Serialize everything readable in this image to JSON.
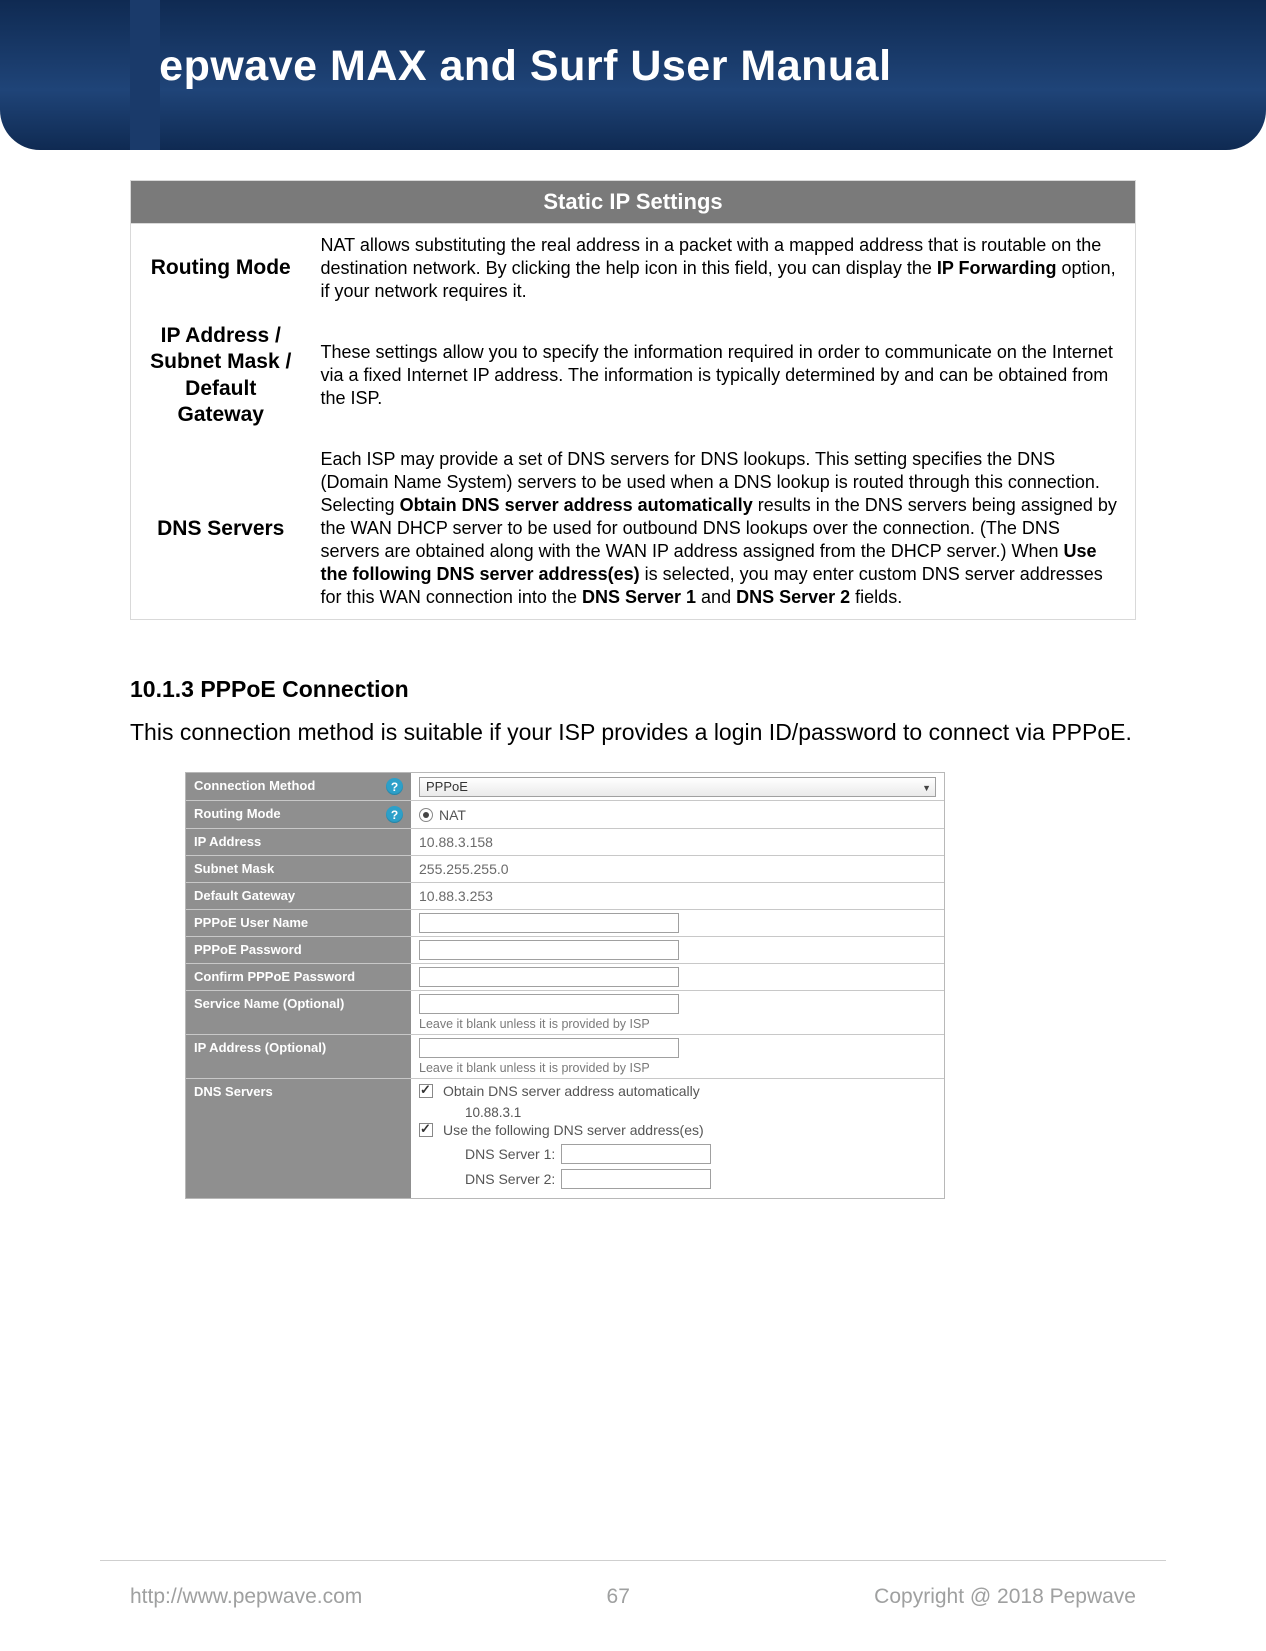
{
  "header": {
    "title": "Pepwave MAX and Surf User Manual"
  },
  "static_ip": {
    "title": "Static IP Settings",
    "rows": [
      {
        "label": "Routing Mode",
        "desc_pre": "NAT allows substituting the real address in a packet with a mapped address that is routable on the destination network. By clicking the help icon in this field, you can display the ",
        "bold1": "IP Forwarding",
        "desc_post": " option, if your network requires it."
      },
      {
        "label": "IP Address / Subnet Mask / Default Gateway",
        "desc_pre": "These settings allow you to specify the information required in order to communicate on the Internet via a fixed Internet IP address. The information is typically determined by and can be obtained from the ISP.",
        "bold1": "",
        "desc_post": ""
      },
      {
        "label": "DNS Servers",
        "desc_pre": "Each ISP may provide a set of DNS servers for DNS lookups. This setting specifies the DNS (Domain Name System) servers to be used when a DNS lookup is routed through this connection. Selecting ",
        "bold1": "Obtain DNS server address automatically",
        "desc_mid1": " results in the DNS servers being assigned by the WAN DHCP server to be used for outbound DNS lookups over the connection. (The DNS servers are obtained along with the WAN IP address assigned from the DHCP server.) When ",
        "bold2": "Use the following DNS server address(es)",
        "desc_mid2": " is selected, you may enter custom DNS server addresses for this WAN connection into the ",
        "bold3": "DNS Server 1",
        "desc_mid3": " and ",
        "bold4": "DNS Server 2",
        "desc_post": " fields."
      }
    ]
  },
  "section": {
    "heading": "10.1.3 PPPoE Connection",
    "para": "This connection method is suitable if your ISP provides a login ID/password to connect via PPPoE."
  },
  "config": {
    "rows": {
      "connection_method": {
        "label": "Connection Method",
        "value": "PPPoE"
      },
      "routing_mode": {
        "label": "Routing Mode",
        "value": "NAT"
      },
      "ip_address": {
        "label": "IP Address",
        "value": "10.88.3.158"
      },
      "subnet_mask": {
        "label": "Subnet Mask",
        "value": "255.255.255.0"
      },
      "default_gateway": {
        "label": "Default Gateway",
        "value": "10.88.3.253"
      },
      "pppoe_user": {
        "label": "PPPoE User Name"
      },
      "pppoe_pass": {
        "label": "PPPoE Password"
      },
      "pppoe_pass2": {
        "label": "Confirm PPPoE Password"
      },
      "service_name": {
        "label": "Service Name (Optional)",
        "hint": "Leave it blank unless it is provided by ISP"
      },
      "ip_optional": {
        "label": "IP Address (Optional)",
        "hint": "Leave it blank unless it is provided by ISP"
      },
      "dns": {
        "label": "DNS Servers",
        "opt_auto": "Obtain DNS server address automatically",
        "auto_ip": "10.88.3.1",
        "opt_manual": "Use the following DNS server address(es)",
        "srv1_label": "DNS Server 1:",
        "srv2_label": "DNS Server 2:"
      }
    }
  },
  "footer": {
    "url": "http://www.pepwave.com",
    "page": "67",
    "copyright": "Copyright @ 2018 Pepwave"
  }
}
